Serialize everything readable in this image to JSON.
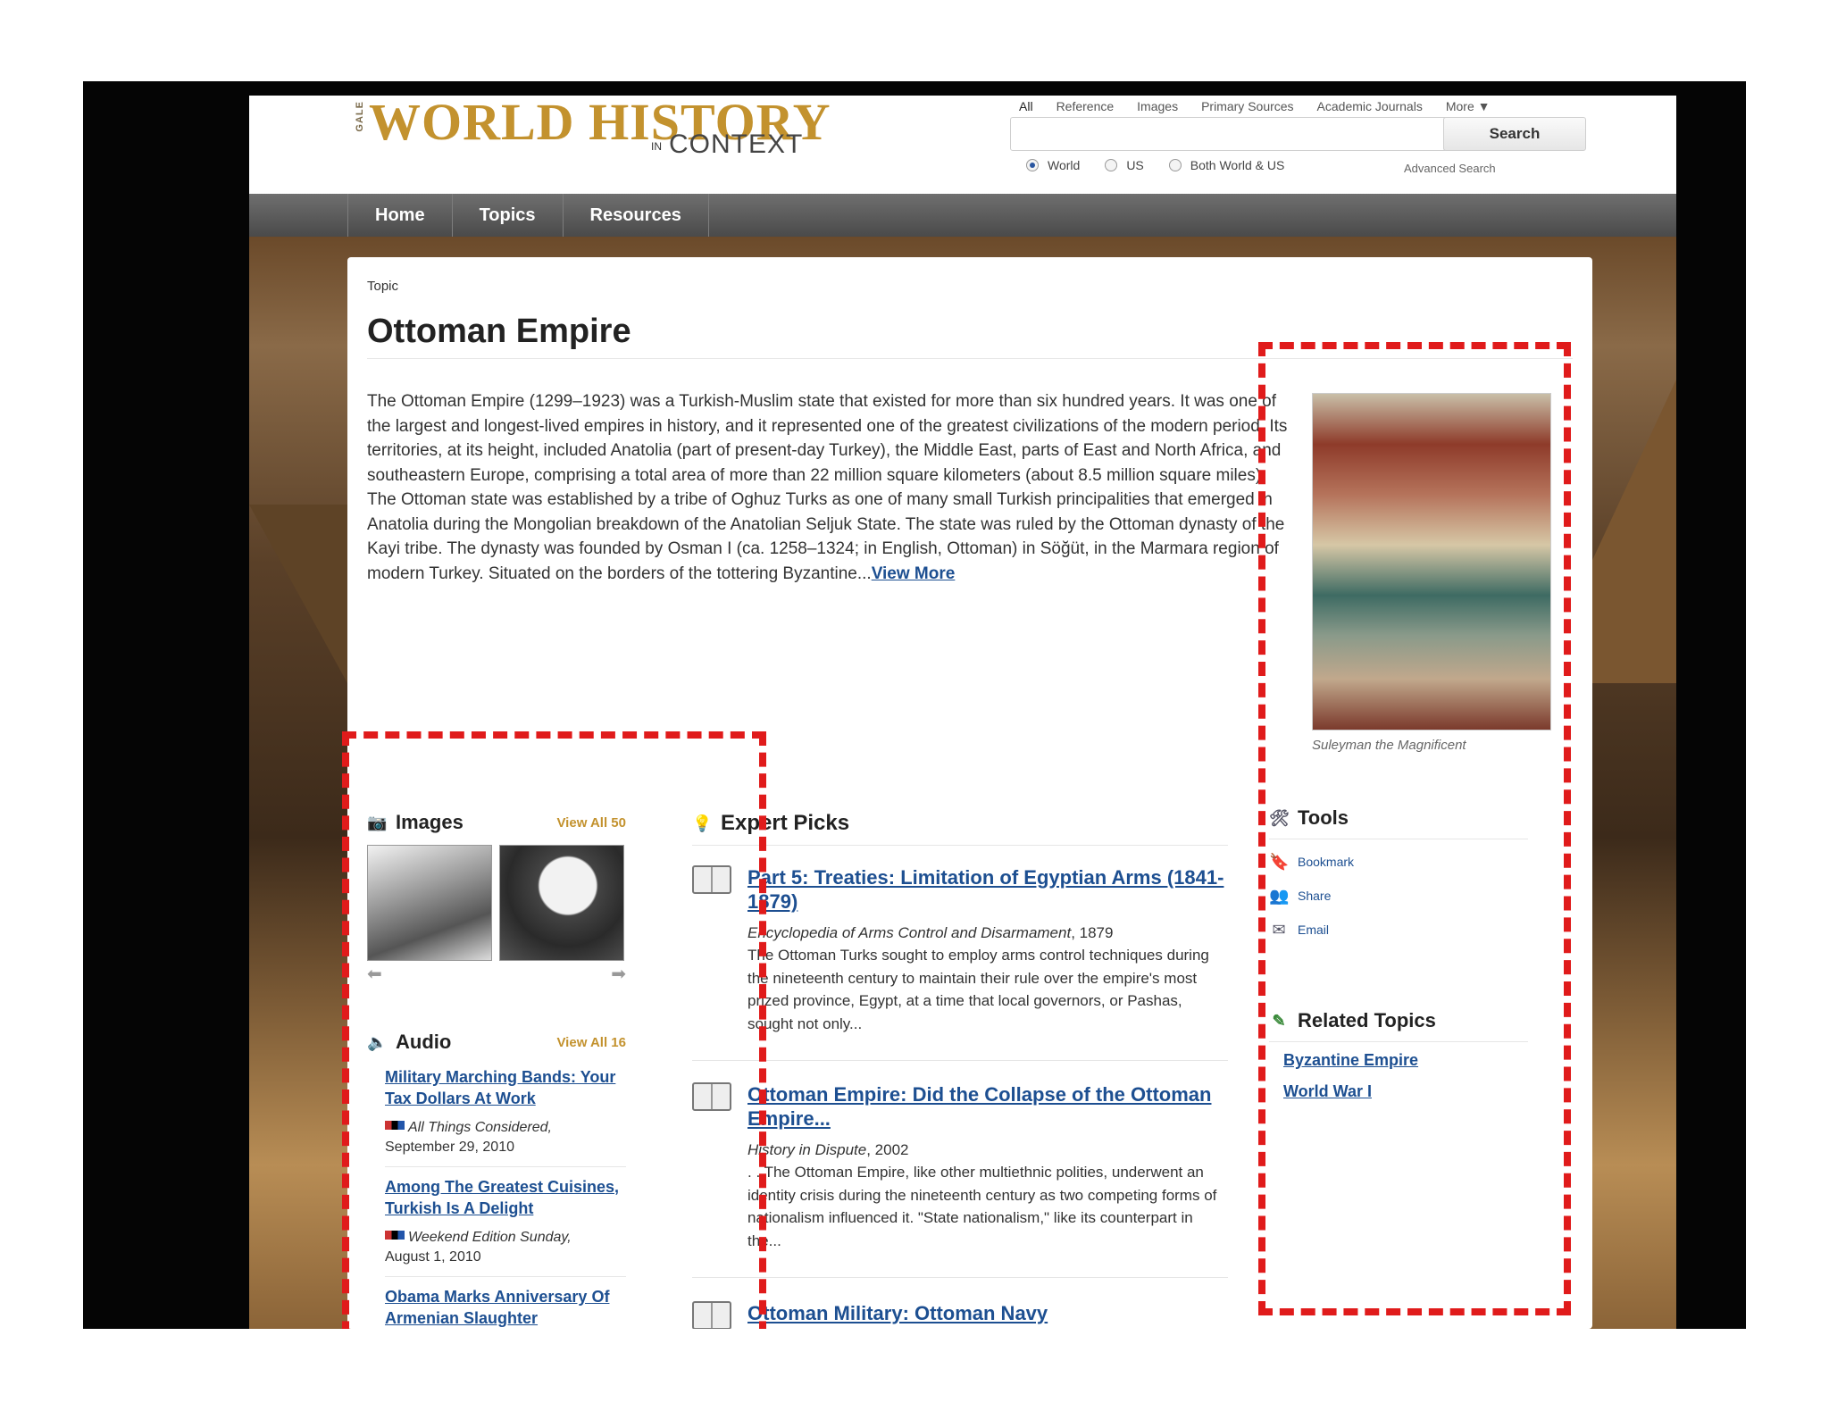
{
  "header": {
    "logo_gale": "GALE",
    "logo_main": "WORLD HISTORY",
    "logo_in": "IN",
    "logo_context": "CONTEXT",
    "search_tabs": [
      "All",
      "Reference",
      "Images",
      "Primary Sources",
      "Academic Journals",
      "More ▼"
    ],
    "search_placeholder": "",
    "search_button": "Search",
    "scope_options": [
      "World",
      "US",
      "Both World & US"
    ],
    "scope_selected": "World",
    "advanced_search": "Advanced Search"
  },
  "nav": {
    "items": [
      "Home",
      "Topics",
      "Resources"
    ]
  },
  "page": {
    "breadcrumb": "Topic",
    "title": "Ottoman Empire",
    "summary": "The Ottoman Empire (1299–1923) was a Turkish-Muslim state that existed for more than six hundred years. It was one of the largest and longest-lived empires in history, and it represented one of the greatest civilizations of the modern period. Its territories, at its height, included Anatolia (part of present-day Turkey), the Middle East, parts of East and North Africa, and southeastern Europe, comprising a total area of more than 22 million square kilometers (about 8.5 million square miles). The Ottoman state was established by a tribe of Oghuz Turks as one of many small Turkish principalities that emerged in Anatolia during the Mongolian breakdown of the Anatolian Seljuk State. The state was ruled by the Ottoman dynasty of the Kayi tribe. The dynasty was founded by Osman I (ca. 1258–1324; in English, Ottoman) in Söğüt, in the Marmara region of modern Turkey. Situated on the borders of the tottering Byzantine...",
    "view_more": "View More",
    "image_caption": "Suleyman the Magnificent"
  },
  "images_section": {
    "title": "Images",
    "view_all": "View All 50"
  },
  "audio_section": {
    "title": "Audio",
    "view_all": "View All 16",
    "items": [
      {
        "title": "Military Marching Bands: Your Tax Dollars At Work",
        "source": "All Things Considered,",
        "date": "September 29, 2010"
      },
      {
        "title": "Among The Greatest Cuisines, Turkish Is A Delight",
        "source": "Weekend Edition Sunday,",
        "date": "August 1, 2010"
      },
      {
        "title": "Obama Marks Anniversary Of Armenian Slaughter",
        "source": "",
        "date": ""
      }
    ]
  },
  "expert_picks": {
    "title": "Expert Picks",
    "items": [
      {
        "title": "Part 5: Treaties: Limitation of Egyptian Arms (1841-1879)",
        "source": "Encyclopedia of Arms Control and Disarmament",
        "year": ", 1879",
        "body": "The Ottoman Turks sought to employ arms control techniques during the nineteenth century to maintain their rule over the empire's most prized province, Egypt, at a time that local governors, or Pashas, sought not only..."
      },
      {
        "title": "Ottoman Empire: Did the Collapse of the Ottoman Empire...",
        "source": "History in Dispute",
        "year": ", 2002",
        "body": ". . The Ottoman Empire, like other multiethnic polities, underwent an identity crisis during the nineteenth century as two competing forms of nationalism influenced it. \"State nationalism,\" like its counterpart in the..."
      },
      {
        "title": "Ottoman Military: Ottoman Navy",
        "source": "",
        "year": "",
        "body": ""
      }
    ]
  },
  "tools": {
    "title": "Tools",
    "items": [
      "Bookmark",
      "Share",
      "Email"
    ]
  },
  "related": {
    "title": "Related Topics",
    "items": [
      "Byzantine Empire",
      "World War I"
    ]
  },
  "colors": {
    "accent_gold": "#c3922e",
    "link_blue": "#1d4f91",
    "annotation_red": "#e01b1b",
    "nav_gray": "#5a5a5a"
  }
}
